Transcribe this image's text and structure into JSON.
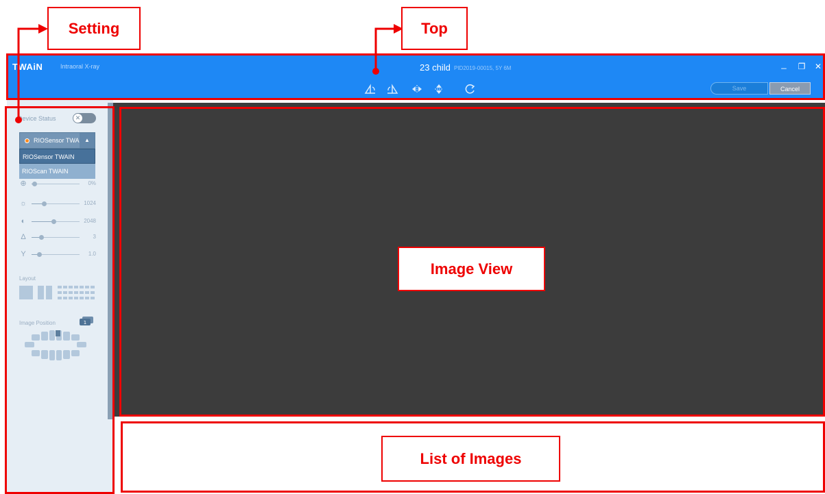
{
  "app": {
    "brand": "TWAiN",
    "subtitle": "Intraoral X-ray",
    "patient_name": "23 child",
    "patient_info": "PID2019-00015, 5Y 6M",
    "minimize": "_",
    "restore": "❐",
    "close": "✕",
    "save_label": "Save",
    "cancel_label": "Cancel",
    "toolbar_icons": [
      "rotate-left-icon",
      "rotate-right-icon",
      "flip-horizontal-icon",
      "flip-vertical-icon",
      "reset-icon"
    ]
  },
  "sidebar": {
    "device_status_label": "Device Status",
    "device_status_toggle": "✕",
    "device_selected": "RIOSensor TWAIN",
    "device_options": [
      "RIOSensor TWAIN",
      "RIOScan TWAIN"
    ],
    "sliders": [
      {
        "icon": "zoom-icon",
        "glyph": "⊕",
        "value_text": "0%",
        "level": 0.05
      },
      {
        "icon": "brightness-icon",
        "glyph": "☼",
        "value_text": "1024",
        "level": 0.25
      },
      {
        "icon": "contrast-icon",
        "glyph": "◐",
        "value_text": "2048",
        "level": 0.45
      },
      {
        "icon": "sharpen-icon",
        "glyph": "Δ",
        "value_text": "3",
        "level": 0.2
      },
      {
        "icon": "gamma-icon",
        "glyph": "Y",
        "value_text": "1.0",
        "level": 0.15
      }
    ],
    "layout_label": "Layout",
    "image_position_label": "Image Position",
    "image_position_badge": "1"
  },
  "annotations": {
    "setting": "Setting",
    "top": "Top",
    "image_view": "Image View",
    "list_of_images": "List of Images"
  },
  "colors": {
    "titlebar": "#1e88f5",
    "annotation": "#ee0000",
    "image_view": "#3c3c3c",
    "sidebar": "#e6eef5"
  }
}
